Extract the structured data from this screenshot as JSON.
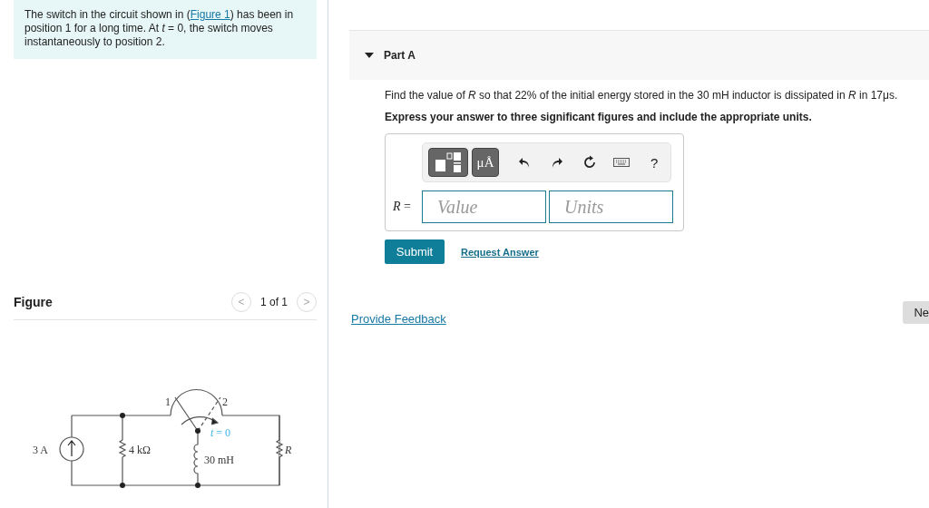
{
  "intro": {
    "before": "The switch in the circuit shown in (",
    "link": "Figure 1",
    "after": ") has been in position 1 for a long time. At *t* = 0, the switch moves instantaneously to position 2."
  },
  "figure": {
    "title": "Figure",
    "pager": "1 of 1",
    "prev": "<",
    "next": ">",
    "labels": [
      {
        "kind": "pos1",
        "text": "1"
      },
      {
        "kind": "pos2",
        "text": "2"
      },
      {
        "kind": "time",
        "text": "*t* = 0"
      },
      {
        "kind": "source",
        "text": "3 A"
      },
      {
        "kind": "r1",
        "text": "4 kΩ"
      },
      {
        "kind": "inductor",
        "text": "30 mH"
      },
      {
        "kind": "r",
        "text": "*R*"
      }
    ]
  },
  "part": {
    "title": "Part A",
    "expanded": true,
    "question": "Find the value of *R* so that 22% of the initial energy stored in the 30 mH inductor is dissipated in *R* in 17μs.",
    "instruction": "Express your answer to three significant figures and include the appropriate units.",
    "units_button": "μÅ",
    "help_button": "?",
    "variable": "*R* =",
    "value_placeholder": "Value",
    "units_placeholder": "Units",
    "submit": "Submit",
    "request": "Request Answer"
  },
  "feedback": "Provide Feedback",
  "next": "Ne"
}
